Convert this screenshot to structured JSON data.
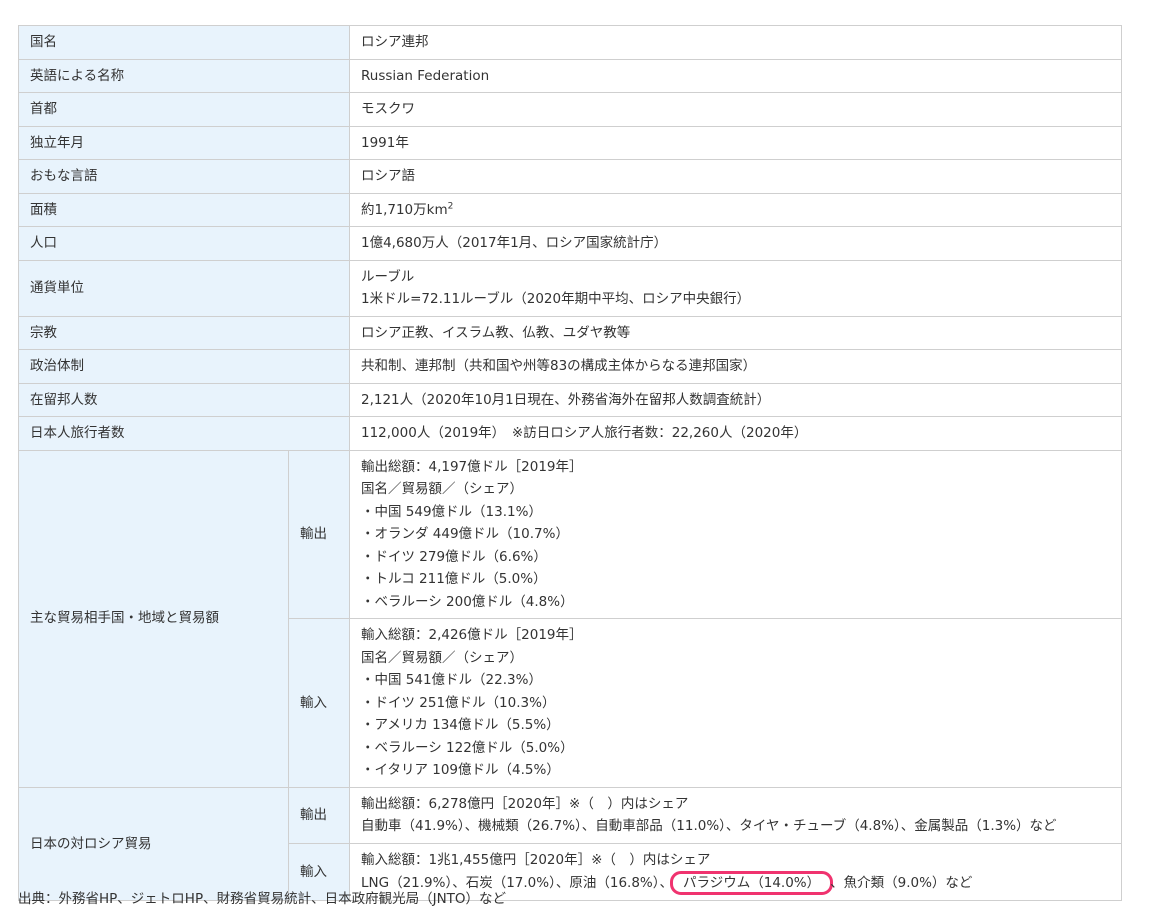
{
  "rows": [
    {
      "label": "国名",
      "value": "ロシア連邦"
    },
    {
      "label": "英語による名称",
      "value": "Russian Federation"
    },
    {
      "label": "首都",
      "value": "モスクワ"
    },
    {
      "label": "独立年月",
      "value": "1991年"
    },
    {
      "label": "おもな言語",
      "value": "ロシア語"
    },
    {
      "label": "面積",
      "value": "約1,710万km",
      "sup": "2"
    },
    {
      "label": "人口",
      "value": "1億4,680万人（2017年1月、ロシア国家統計庁）"
    },
    {
      "label": "通貨単位",
      "lines": [
        "ルーブル",
        "1米ドル=72.11ルーブル（2020年期中平均、ロシア中央銀行）"
      ]
    },
    {
      "label": "宗教",
      "value": "ロシア正教、イスラム教、仏教、ユダヤ教等"
    },
    {
      "label": "政治体制",
      "value": "共和制、連邦制（共和国や州等83の構成主体からなる連邦国家）"
    },
    {
      "label": "在留邦人数",
      "value": "2,121人（2020年10月1日現在、外務省海外在留邦人数調査統計）"
    },
    {
      "label": "日本人旅行者数",
      "value": "112,000人（2019年）　※訪日ロシア人旅行者数：22,260人（2020年）"
    }
  ],
  "trade_partners": {
    "label": "主な貿易相手国・地域と貿易額",
    "export": {
      "label": "輸出",
      "lines": [
        "輸出総額：4,197億ドル［2019年］",
        "国名／貿易額／（シェア）",
        "・中国 549億ドル（13.1%）",
        "・オランダ 449億ドル（10.7%）",
        "・ドイツ 279億ドル（6.6%）",
        "・トルコ 211億ドル（5.0%）",
        "・ベラルーシ 200億ドル（4.8%）"
      ]
    },
    "import": {
      "label": "輸入",
      "lines": [
        "輸入総額：2,426億ドル［2019年］",
        "国名／貿易額／（シェア）",
        "・中国 541億ドル（22.3%）",
        "・ドイツ 251億ドル（10.3%）",
        "・アメリカ 134億ドル（5.5%）",
        "・ベラルーシ 122億ドル（5.0%）",
        "・イタリア 109億ドル（4.5%）"
      ]
    }
  },
  "japan_trade": {
    "label": "日本の対ロシア貿易",
    "export": {
      "label": "輸出",
      "line1": "輸出総額：6,278億円［2020年］※（　）内はシェア",
      "line2": "自動車（41.9%）、機械類（26.7%）、自動車部品（11.0%）、タイヤ・チューブ（4.8%）、金属製品（1.3%）など"
    },
    "import": {
      "label": "輸入",
      "line1": "輸入総額：1兆1,455億円［2020年］※（　）内はシェア",
      "line2_before": "LNG（21.9%）、石炭（17.0%）、原油（16.8%）、",
      "line2_highlight": "パラジウム（14.0%）",
      "line2_after": "、魚介類（9.0%）など",
      "highlight_color": "#f0336f"
    }
  },
  "source": "出典：外務省HP、ジェトロHP、財務省貿易統計、日本政府観光局（JNTO）など"
}
